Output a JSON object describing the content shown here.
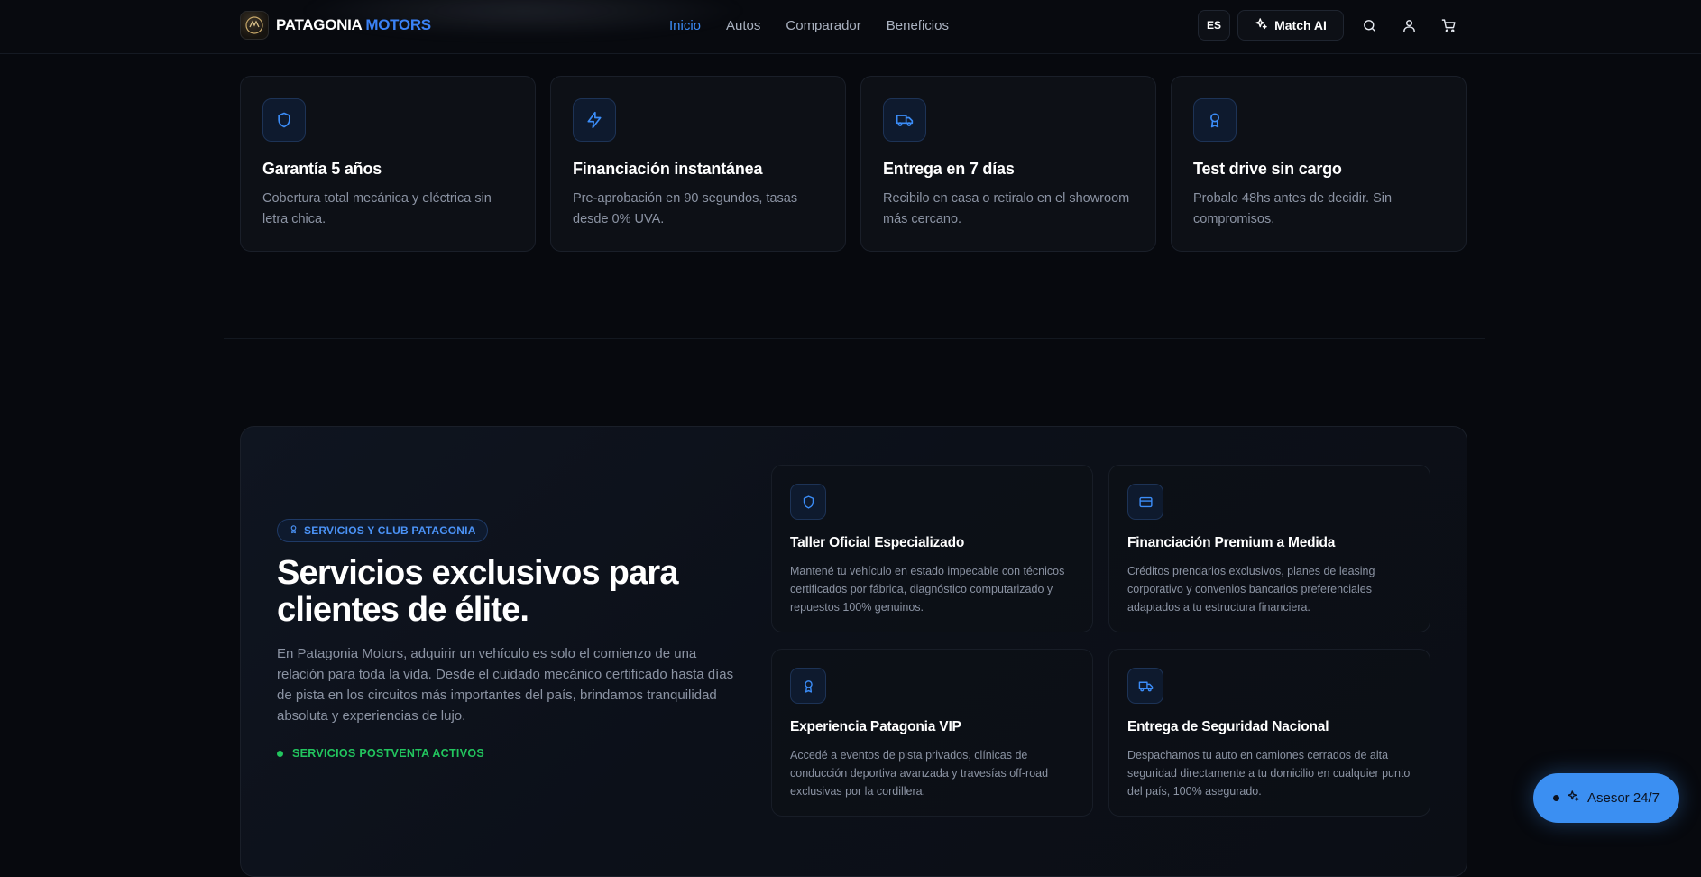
{
  "header": {
    "brand_part1": "PATAGONIA",
    "brand_part2": "MOTORS",
    "nav": [
      {
        "label": "Inicio",
        "active": true
      },
      {
        "label": "Autos",
        "active": false
      },
      {
        "label": "Comparador",
        "active": false
      },
      {
        "label": "Beneficios",
        "active": false
      }
    ],
    "lang_label": "ES",
    "match_label": "Match AI",
    "icons": [
      "search-icon",
      "user-icon",
      "cart-icon"
    ]
  },
  "features": [
    {
      "icon": "shield-icon",
      "title": "Garantía 5 años",
      "desc": "Cobertura total mecánica y eléctrica sin letra chica."
    },
    {
      "icon": "lightning-icon",
      "title": "Financiación instantánea",
      "desc": "Pre-aprobación en 90 segundos, tasas desde 0% UVA."
    },
    {
      "icon": "truck-icon",
      "title": "Entrega en 7 días",
      "desc": "Recibilo en casa o retiralo en el showroom más cercano."
    },
    {
      "icon": "award-icon",
      "title": "Test drive sin cargo",
      "desc": "Probalo 48hs antes de decidir. Sin compromisos."
    }
  ],
  "services": {
    "badge": "SERVICIOS Y CLUB PATAGONIA",
    "title": "Servicios exclusivos para clientes de élite.",
    "description": "En Patagonia Motors, adquirir un vehículo es solo el comienzo de una relación para toda la vida. Desde el cuidado mecánico certificado hasta días de pista en los circuitos más importantes del país, brindamos tranquilidad absoluta y experiencias de lujo.",
    "status": "SERVICIOS POSTVENTA ACTIVOS",
    "items": [
      {
        "icon": "shield-icon",
        "title": "Taller Oficial Especializado",
        "desc": "Mantené tu vehículo en estado impecable con técnicos certificados por fábrica, diagnóstico computarizado y repuestos 100% genuinos."
      },
      {
        "icon": "credit-card-icon",
        "title": "Financiación Premium a Medida",
        "desc": "Créditos prendarios exclusivos, planes de leasing corporativo y convenios bancarios preferenciales adaptados a tu estructura financiera."
      },
      {
        "icon": "award-icon",
        "title": "Experiencia Patagonia VIP",
        "desc": "Accedé a eventos de pista privados, clínicas de conducción deportiva avanzada y travesías off-road exclusivas por la cordillera."
      },
      {
        "icon": "truck-icon",
        "title": "Entrega de Seguridad Nacional",
        "desc": "Despachamos tu auto en camiones cerrados de alta seguridad directamente a tu domicilio en cualquier punto del país, 100% asegurado."
      }
    ]
  },
  "chat": {
    "label": "Asesor 24/7"
  },
  "colors": {
    "accent": "#3b82f6",
    "success": "#22c55e",
    "background": "#07090e"
  }
}
